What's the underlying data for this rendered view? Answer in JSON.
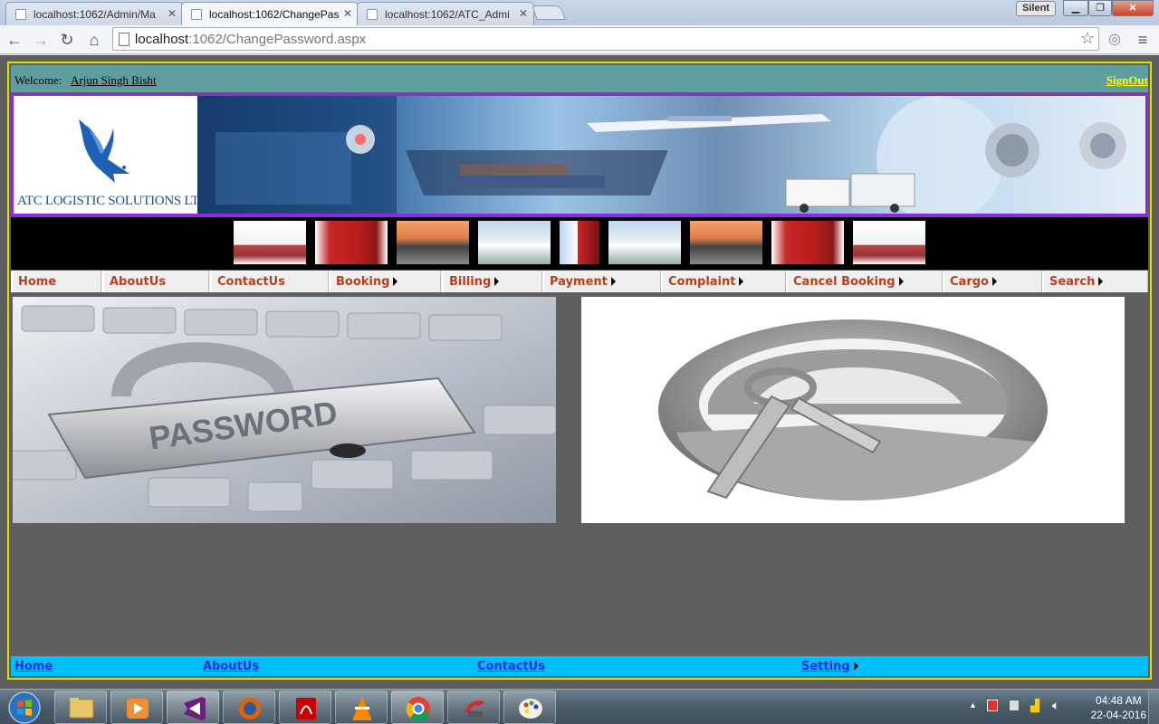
{
  "browser": {
    "tabs": [
      {
        "title": "localhost:1062/Admin/Ma",
        "active": false
      },
      {
        "title": "localhost:1062/ChangePas",
        "active": true
      },
      {
        "title": "localhost:1062/ATC_Admi",
        "active": false
      }
    ],
    "silent_label": "Silent",
    "url_host": "localhost",
    "url_path": ":1062/ChangePassword.aspx"
  },
  "page": {
    "welcome_label": "Welcome:",
    "user_name": "Arjun Singh Bisht",
    "signout_label": "SignOut",
    "logo_text": "ATC LOGISTIC SOLUTIONS LTD.",
    "menu": [
      {
        "label": "Home",
        "has_submenu": false
      },
      {
        "label": "AboutUs",
        "has_submenu": false
      },
      {
        "label": "ContactUs",
        "has_submenu": false
      },
      {
        "label": "Booking",
        "has_submenu": true
      },
      {
        "label": "Billing",
        "has_submenu": true
      },
      {
        "label": "Payment",
        "has_submenu": true
      },
      {
        "label": "Complaint",
        "has_submenu": true
      },
      {
        "label": "Cancel Booking",
        "has_submenu": true
      },
      {
        "label": "Cargo",
        "has_submenu": true
      },
      {
        "label": "Search",
        "has_submenu": true
      }
    ],
    "banner_image_text": "PASSWORD",
    "footer": [
      {
        "label": "Home",
        "has_submenu": false
      },
      {
        "label": "AboutUs",
        "has_submenu": false
      },
      {
        "label": "ContactUs",
        "has_submenu": false
      },
      {
        "label": "Setting",
        "has_submenu": true
      }
    ],
    "colors": {
      "welcome_bar": "#5f9ea0",
      "signout": "#ffff00",
      "frame_border": "#e0e000",
      "banner_border": "#8a2be2",
      "menu_text": "#b8401d",
      "footer_bg": "#00bfff",
      "footer_link": "#2a2ae0",
      "page_bg": "#5f5f5f"
    }
  },
  "taskbar": {
    "apps": [
      "start-orb",
      "file-explorer",
      "media-player",
      "visual-studio",
      "firefox",
      "acrobat-reader",
      "vlc",
      "chrome",
      "ccleaner",
      "paint"
    ],
    "clock_time": "04:48 AM",
    "clock_date": "22-04-2016"
  }
}
